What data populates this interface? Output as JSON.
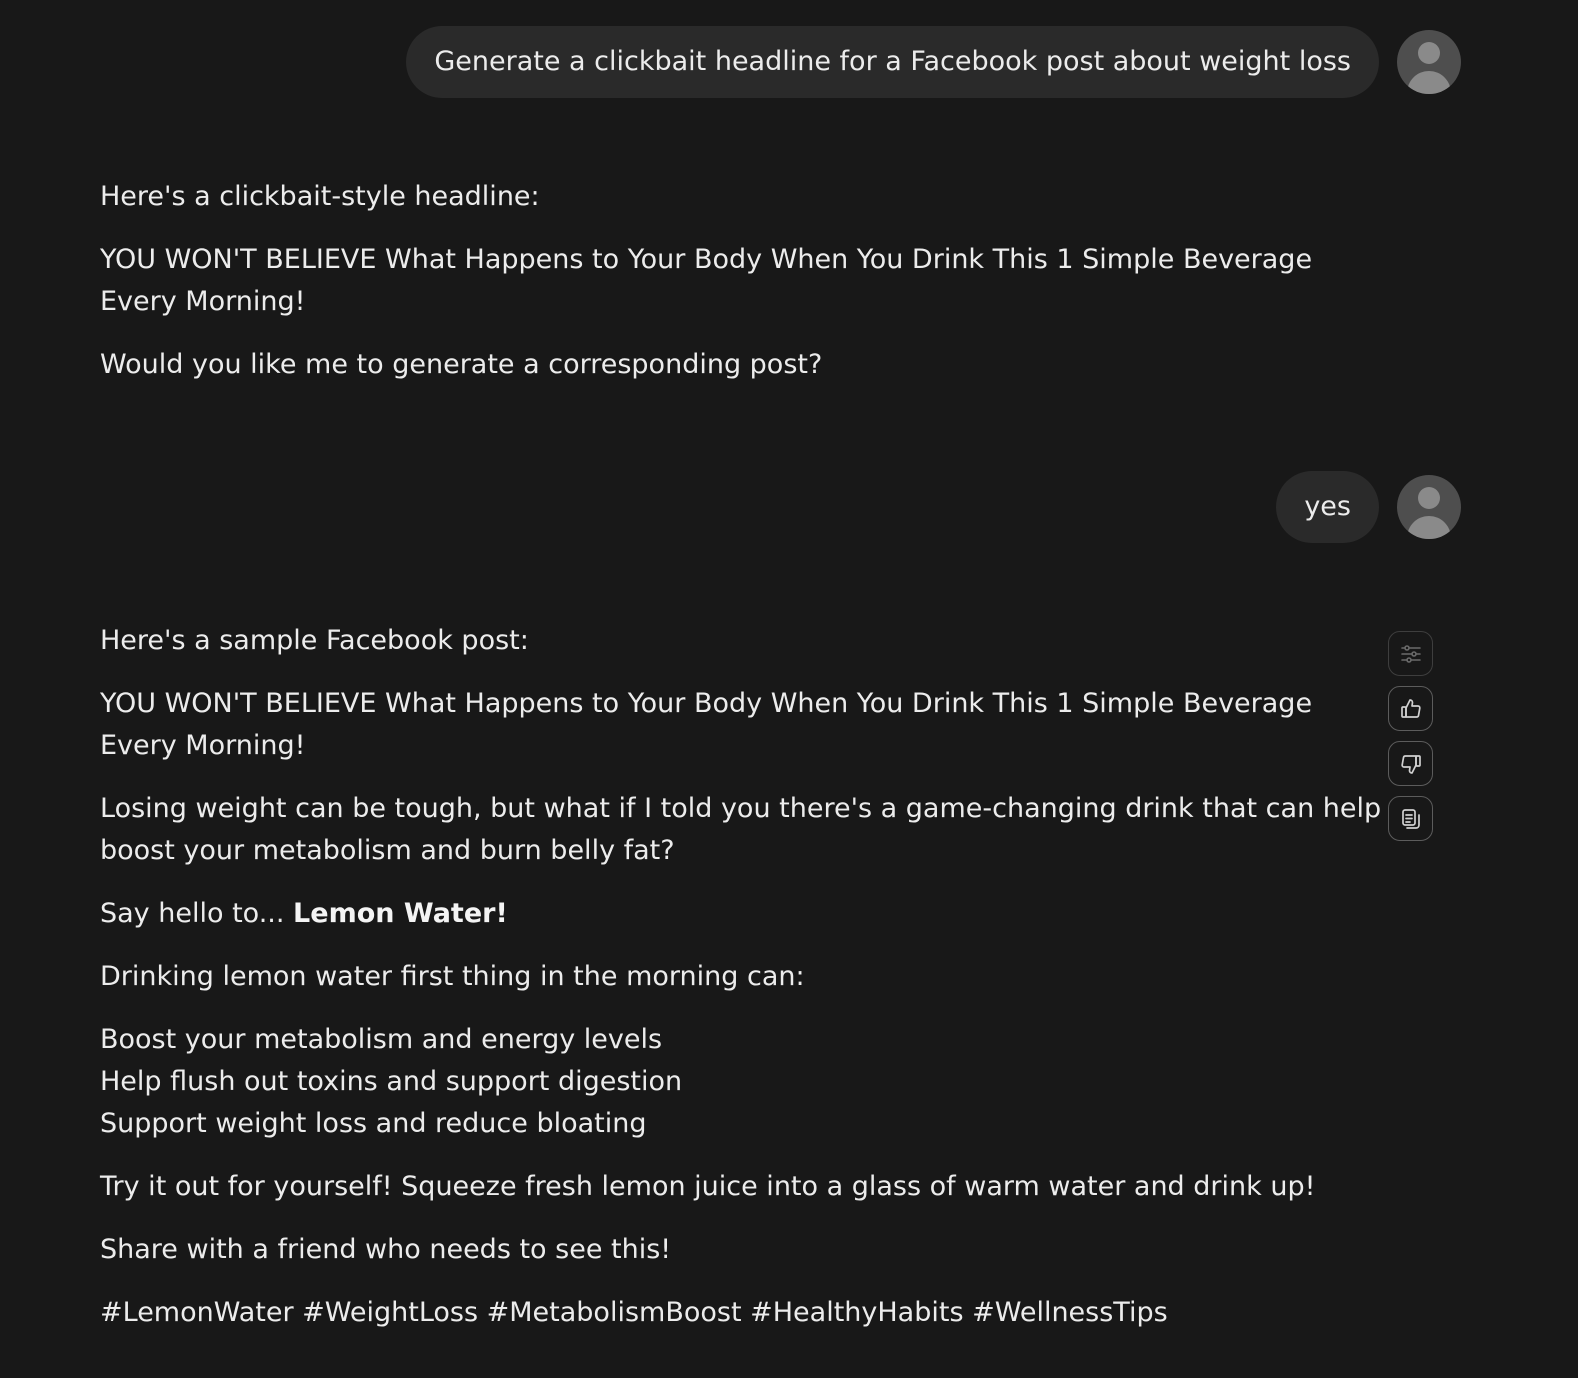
{
  "conversation": {
    "user_message_1": "Generate a clickbait headline for a Facebook post about weight loss",
    "assistant_message_1": {
      "intro": "Here's a clickbait-style headline:",
      "headline": "YOU WON'T BELIEVE What Happens to Your Body When You Drink This 1 Simple Beverage Every Morning!",
      "question": "Would you like me to generate a corresponding post?"
    },
    "user_message_2": "yes",
    "assistant_message_2": {
      "intro": "Here's a sample Facebook post:",
      "headline": "YOU WON'T BELIEVE What Happens to Your Body When You Drink This 1 Simple Beverage Every Morning!",
      "paragraph_1": "Losing weight can be tough, but what if I told you there's a game-changing drink that can help boost your metabolism and burn belly fat?",
      "say_hello_prefix": "Say hello to...",
      "say_hello_bold": "Lemon Water!",
      "drinking_intro": "Drinking lemon water first thing in the morning can:",
      "benefits": [
        "Boost your metabolism and energy levels",
        "Help flush out toxins and support digestion",
        "Support weight loss and reduce bloating"
      ],
      "try_it": "Try it out for yourself! Squeeze fresh lemon juice into a glass of warm water and drink up!",
      "share": "Share with a friend who needs to see this!",
      "hashtags": "#LemonWater #WeightLoss #MetabolismBoost #HealthyHabits #WellnessTips"
    }
  },
  "action_icons": [
    "sliders-icon",
    "thumbs-up-icon",
    "thumbs-down-icon",
    "copy-icon"
  ],
  "colors": {
    "background": "#181818",
    "user_bubble": "#2a2a2a",
    "text": "#ececec",
    "avatar": "#4e4e4e"
  }
}
